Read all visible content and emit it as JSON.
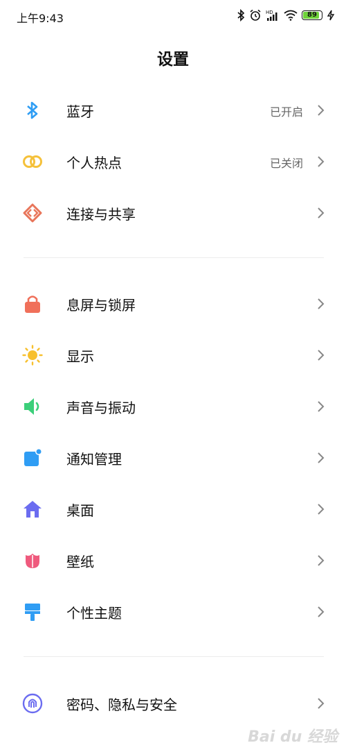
{
  "status_bar": {
    "time": "上午9:43",
    "battery_level": "89",
    "icons": [
      "bluetooth-icon",
      "alarm-icon",
      "hd-signal-icon",
      "wifi-icon",
      "battery-icon",
      "charging-icon"
    ]
  },
  "page_title": "设置",
  "groups": [
    {
      "items": [
        {
          "label": "蓝牙",
          "value": "已开启",
          "icon": "bluetooth-icon",
          "color": "#2f9df4"
        },
        {
          "label": "个人热点",
          "value": "已关闭",
          "icon": "hotspot-icon",
          "color": "#f5c13a"
        },
        {
          "label": "连接与共享",
          "value": "",
          "icon": "connection-icon",
          "color": "#e8755a"
        }
      ]
    },
    {
      "items": [
        {
          "label": "息屏与锁屏",
          "value": "",
          "icon": "lock-icon",
          "color": "#f0705a"
        },
        {
          "label": "显示",
          "value": "",
          "icon": "sun-icon",
          "color": "#f7c02e"
        },
        {
          "label": "声音与振动",
          "value": "",
          "icon": "speaker-icon",
          "color": "#3ccf7a"
        },
        {
          "label": "通知管理",
          "value": "",
          "icon": "notification-icon",
          "color": "#2f9df4"
        },
        {
          "label": "桌面",
          "value": "",
          "icon": "home-icon",
          "color": "#6b6cf0"
        },
        {
          "label": "壁纸",
          "value": "",
          "icon": "flower-icon",
          "color": "#ef5a7d"
        },
        {
          "label": "个性主题",
          "value": "",
          "icon": "brush-icon",
          "color": "#2f9df4"
        }
      ]
    },
    {
      "items": [
        {
          "label": "密码、隐私与安全",
          "value": "",
          "icon": "fingerprint-icon",
          "color": "#6b6cf0"
        }
      ]
    }
  ],
  "watermark": "Bai du 经验"
}
